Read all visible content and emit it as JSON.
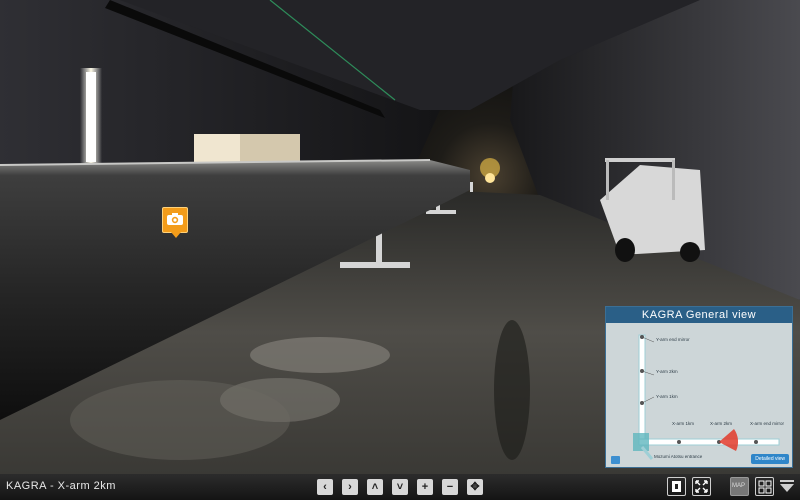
{
  "title_bar": {
    "caption": "KAGRA - X-arm 2km"
  },
  "minimap": {
    "title": "KAGRA General view",
    "labels": {
      "y_end": "Y-arm end mirror",
      "y_2km": "Y-arm 2km",
      "y_1km": "Y-arm 1km",
      "x_1km": "X-arm 1km",
      "x_2km": "X-arm 2km",
      "x_end": "X-arm end mirror",
      "entrance": "Mozumi Atotsu entrance"
    },
    "detail_button": "Detailed view",
    "colors": {
      "header": "#2a5f87",
      "tunnel": "#9ecfd6",
      "view_cone": "#e23a2a"
    }
  },
  "hotspot": {
    "icon": "camera-icon",
    "color": "#f39c1a"
  },
  "toolbar": {
    "nav_buttons": [
      {
        "name": "pan-left-button",
        "glyph": "‹"
      },
      {
        "name": "pan-right-button",
        "glyph": "›"
      },
      {
        "name": "pan-up-button",
        "glyph": "˄"
      },
      {
        "name": "pan-down-button",
        "glyph": "˅"
      },
      {
        "name": "zoom-in-button",
        "glyph": "+"
      },
      {
        "name": "zoom-out-button",
        "glyph": "−"
      },
      {
        "name": "move-button",
        "glyph": "✥"
      }
    ],
    "map_label": "MAP"
  }
}
